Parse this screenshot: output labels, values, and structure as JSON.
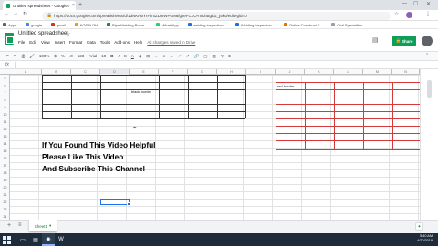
{
  "browser": {
    "tab_title": "Untitled spreadsheet - Google Sh",
    "tab_close": "×",
    "new_tab": "+",
    "url": "https://docs.google.com/spreadsheets/d/1dNKRbYrFi7xZDRWP0M6fgkeFC1O-nIKhBgbjz_j5ko/edit#gid=0",
    "bookmarks": [
      "Apps",
      "google",
      "gmail",
      "KOSPLOH",
      "Pipe Welding Proce...",
      "WhatsApp",
      "welding inspection...",
      "Welding Inspection...",
      "Online Construct F...",
      "Civil Specialties"
    ]
  },
  "sheets": {
    "doc_title": "Untitled spreadsheet",
    "menu": [
      "File",
      "Edit",
      "View",
      "Insert",
      "Format",
      "Data",
      "Tools",
      "Add-ons",
      "Help"
    ],
    "saved_status": "All changes saved in Drive",
    "share_label": "Share",
    "zoom": "100%",
    "font_name": "Arial",
    "font_size": "10",
    "fx": "fx",
    "columns": [
      "A",
      "B",
      "C",
      "D",
      "E",
      "F",
      "G",
      "H",
      "I",
      "J",
      "K",
      "L",
      "M",
      "N"
    ],
    "rows": [
      "5",
      "6",
      "7",
      "8",
      "9",
      "10",
      "11",
      "12",
      "13",
      "14",
      "15",
      "16",
      "17",
      "18",
      "19",
      "20",
      "21",
      "22",
      "23",
      "24"
    ],
    "cell_black_border": "black border",
    "cell_red_border": "red border",
    "sheet_tab": "Sheet1",
    "sheet_tab_arrow": "▾"
  },
  "overlay": {
    "line1": "If You Found This Video Helpful",
    "line2": "Please Like This Video",
    "line3": "And Subscribe This Channel"
  },
  "taskbar": {
    "time": "5:40 AM",
    "date": "4/20/2019"
  },
  "colors": {
    "sheets_green": "#0f9d58",
    "red_border": "#d33a3a",
    "selection_blue": "#1a73e8",
    "taskbar": "#1d2b3a"
  }
}
